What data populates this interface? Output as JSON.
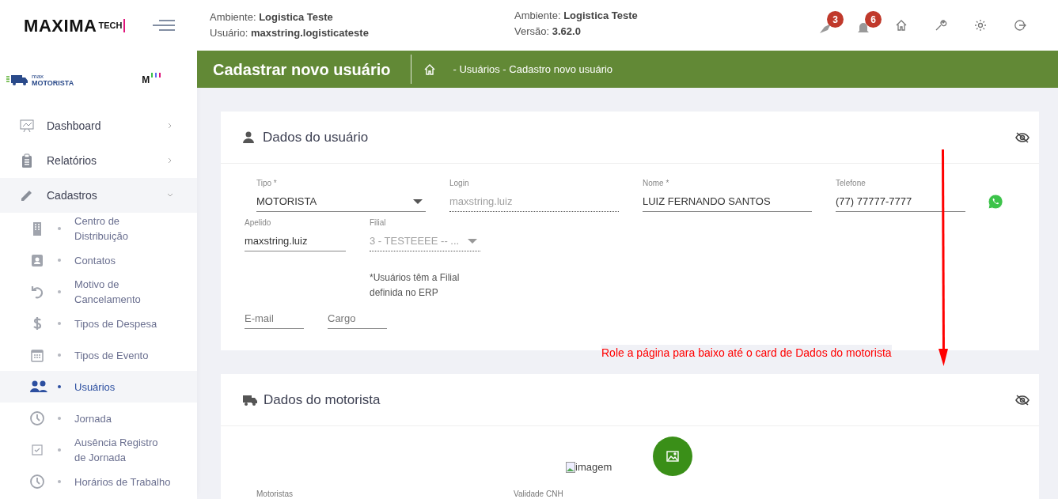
{
  "header": {
    "logo": {
      "name": "MAXIMA",
      "suffix": "TECH"
    },
    "info_left": [
      {
        "label": "Ambiente:",
        "value": "Logistica Teste"
      },
      {
        "label": "Usuário:",
        "value": "maxstring.logisticateste"
      }
    ],
    "info_right": [
      {
        "label": "Ambiente:",
        "value": "Logistica Teste"
      },
      {
        "label": "Versão:",
        "value": "3.62.0"
      }
    ],
    "badges": [
      {
        "kind": "pin",
        "count": "3"
      },
      {
        "kind": "bell",
        "count": "6"
      }
    ]
  },
  "sidebar": {
    "brand": {
      "small": "max",
      "name": "MOTORISTA",
      "mini": "M"
    },
    "items": [
      {
        "label": "Dashboard",
        "kind": "chart",
        "expanded": false
      },
      {
        "label": "Relatórios",
        "kind": "clipboard",
        "expanded": false
      },
      {
        "label": "Cadastros",
        "kind": "pencil",
        "expanded": true,
        "children": [
          {
            "label": "Centro de Distribuição",
            "kind": "building",
            "selected": false
          },
          {
            "label": "Contatos",
            "kind": "contact",
            "selected": false
          },
          {
            "label": "Motivo de Cancelamento",
            "kind": "undo",
            "selected": false
          },
          {
            "label": "Tipos de Despesa",
            "kind": "dollar",
            "selected": false
          },
          {
            "label": "Tipos de Evento",
            "kind": "calendar",
            "selected": false
          },
          {
            "label": "Usuários",
            "kind": "users",
            "selected": true
          },
          {
            "label": "Jornada",
            "kind": "clock",
            "selected": false
          },
          {
            "label": "Ausência Registro de Jornada",
            "kind": "check",
            "selected": false
          },
          {
            "label": "Horários de Trabalho",
            "kind": "clock",
            "selected": false
          }
        ]
      }
    ]
  },
  "page": {
    "title": "Cadastrar novo usuário",
    "breadcrumb": "- Usuários - Cadastro novo usuário"
  },
  "user_card": {
    "title": "Dados do usuário",
    "rows": [
      [
        {
          "kind": "select",
          "label": "Tipo *",
          "value": "MOTORISTA",
          "disabled": false
        },
        {
          "kind": "text",
          "label": "Login",
          "value": "maxstring.luiz",
          "disabled": true
        },
        {
          "kind": "text",
          "label": "Nome *",
          "value": "LUIZ FERNANDO SANTOS",
          "disabled": false
        },
        {
          "kind": "phone",
          "label": "Telefone",
          "value": "(77) 77777-7777",
          "disabled": false
        }
      ],
      [
        {
          "kind": "text",
          "label": "Apelido",
          "value": "maxstring.luiz",
          "disabled": false
        },
        {
          "kind": "select",
          "label": "Filial",
          "value": "3 - TESTEEEE -- ...",
          "disabled": true,
          "note": "*Usuários têm a Filial definida no ERP"
        }
      ],
      [
        {
          "kind": "text",
          "placeholder": "E-mail",
          "disabled": false
        },
        {
          "kind": "text",
          "placeholder": "Cargo",
          "disabled": false
        }
      ]
    ]
  },
  "annotation": "Role a página para baixo até o card de Dados do motorista",
  "driver_card": {
    "title": "Dados do motorista",
    "image_alt": "imagem",
    "labels": [
      "Motoristas",
      "Validade CNH"
    ]
  }
}
